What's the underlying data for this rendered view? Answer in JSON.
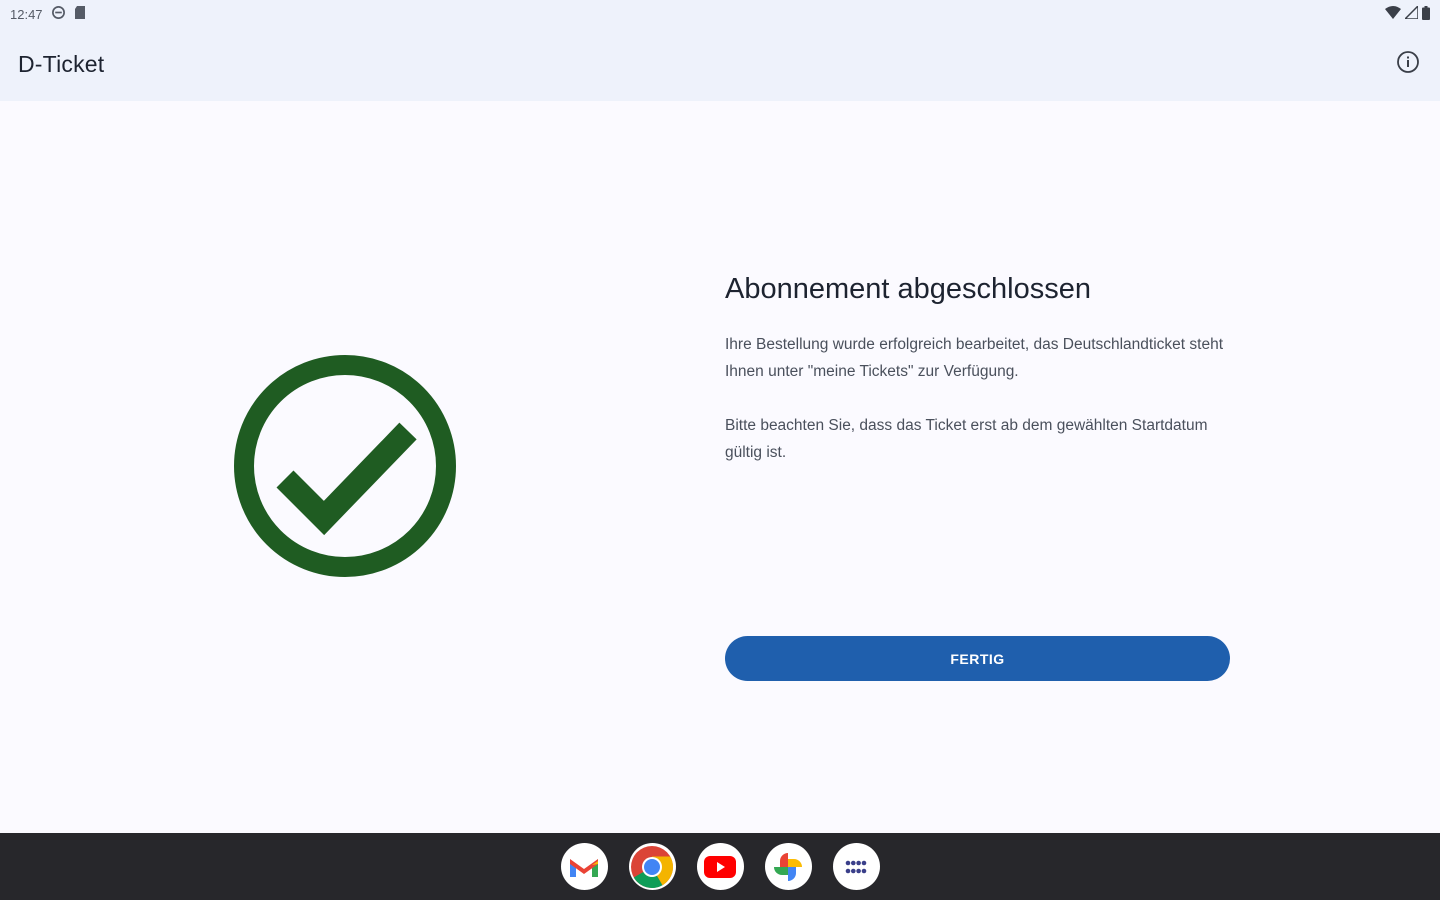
{
  "status_bar": {
    "time": "12:47",
    "icons": [
      "data-saver-icon",
      "sd-card-icon",
      "wifi-icon",
      "cell-signal-icon",
      "battery-icon"
    ]
  },
  "app_bar": {
    "title": "D-Ticket",
    "info_icon": "info-icon"
  },
  "main": {
    "headline": "Abonnement abgeschlossen",
    "paragraph_1": "Ihre Bestellung wurde erfolgreich bearbeitet, das Deutschlandticket steht Ihnen unter \"meine Tickets\" zur Verfügung.",
    "paragraph_2": "Bitte beachten Sie, dass das Ticket erst ab dem gewählten Startdatum gültig ist.",
    "done_button": "FERTIG",
    "success_icon": "check-circle-icon"
  },
  "colors": {
    "success_green": "#1f5c22",
    "primary_blue": "#1f5fad",
    "app_bar_bg": "#eef2fb",
    "taskbar_bg": "#27272b"
  },
  "taskbar": {
    "apps": [
      "gmail-icon",
      "chrome-icon",
      "youtube-icon",
      "photos-icon",
      "app-launcher-icon"
    ]
  }
}
